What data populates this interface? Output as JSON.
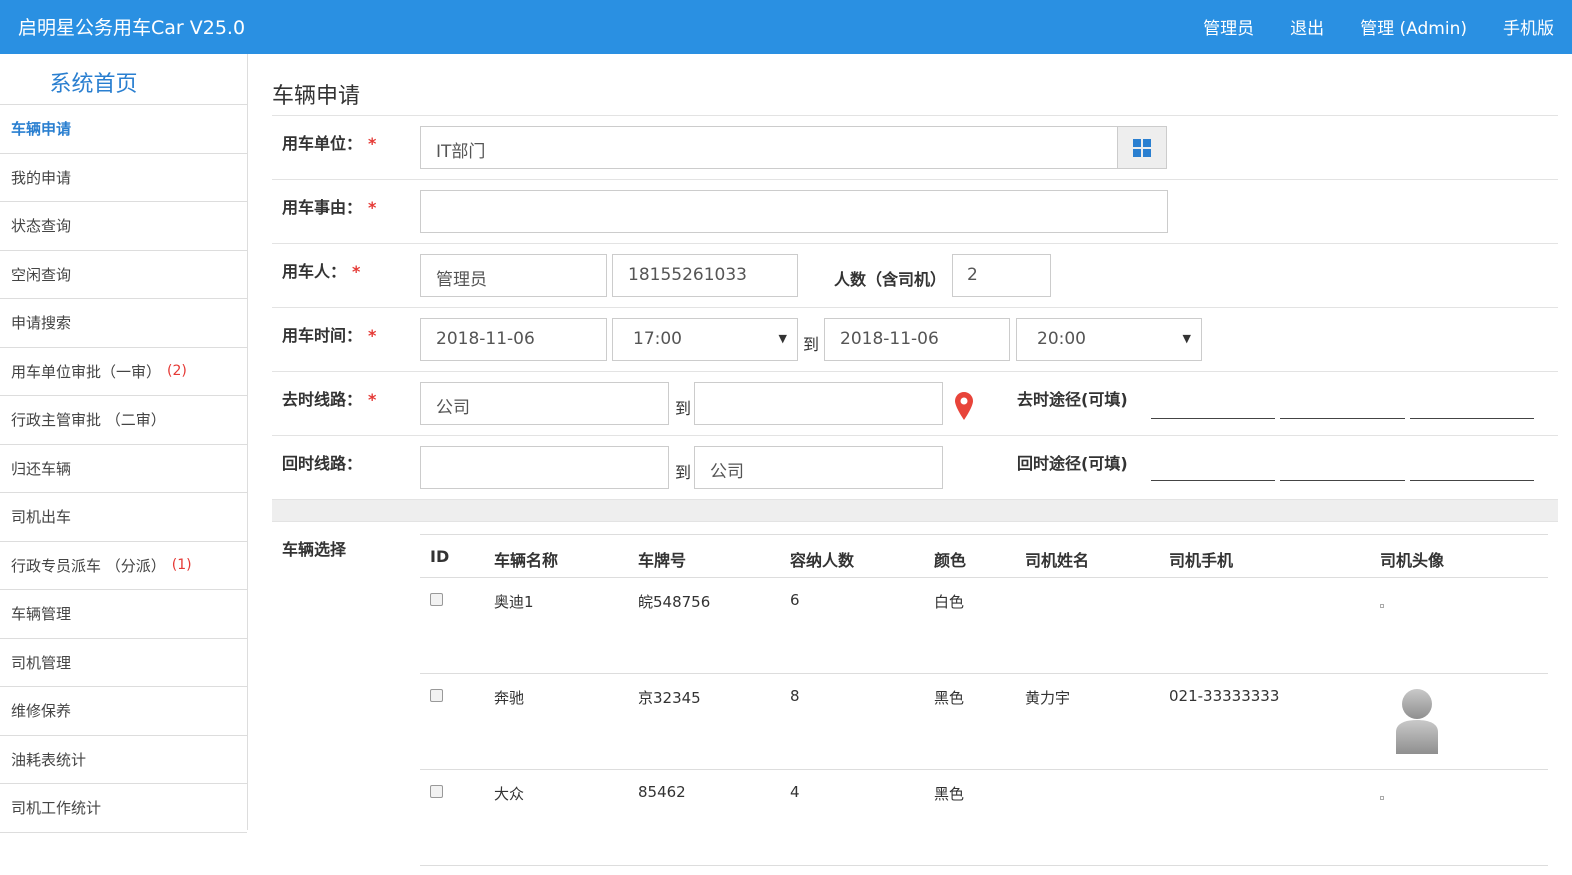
{
  "topbar": {
    "brand": "启明星公务用车Car V25.0",
    "nav": [
      "管理员",
      "退出",
      "管理 (Admin)",
      "手机版"
    ]
  },
  "sidebar": {
    "home": "系统首页",
    "items": [
      {
        "label": "车辆申请",
        "count": ""
      },
      {
        "label": "我的申请",
        "count": ""
      },
      {
        "label": "状态查询",
        "count": ""
      },
      {
        "label": "空闲查询",
        "count": ""
      },
      {
        "label": "申请搜索",
        "count": ""
      },
      {
        "label": "用车单位审批（一审）",
        "count": "(2)"
      },
      {
        "label": "行政主管审批 （二审）",
        "count": ""
      },
      {
        "label": "归还车辆",
        "count": ""
      },
      {
        "label": "司机出车",
        "count": ""
      },
      {
        "label": "行政专员派车 （分派）",
        "count": "(1)"
      },
      {
        "label": "车辆管理",
        "count": ""
      },
      {
        "label": "司机管理",
        "count": ""
      },
      {
        "label": "维修保养",
        "count": ""
      },
      {
        "label": "油耗表统计",
        "count": ""
      },
      {
        "label": "司机工作统计",
        "count": ""
      }
    ]
  },
  "form": {
    "title": "车辆申请",
    "unit_label": "用车单位：",
    "unit_value": "IT部门",
    "reason_label": "用车事由：",
    "reason_value": "",
    "user_label": "用车人：",
    "user_name": "管理员",
    "user_phone": "18155261033",
    "people_label": "人数（含司机）",
    "people_value": "2",
    "time_label": "用车时间：",
    "start_date": "2018-11-06",
    "start_time": "17:00",
    "to": "到",
    "end_date": "2018-11-06",
    "end_time": "20:00",
    "go_label": "去时线路：",
    "go_from": "公司",
    "go_to": "",
    "go_via_label": "去时途径(可填)",
    "back_label": "回时线路：",
    "back_from": "",
    "back_to": "公司",
    "back_via_label": "回时途径(可填)",
    "required_mark": "*"
  },
  "vehicles": {
    "label": "车辆选择",
    "columns": [
      "ID",
      "车辆名称",
      "车牌号",
      "容纳人数",
      "颜色",
      "司机姓名",
      "司机手机",
      "司机头像"
    ],
    "rows": [
      {
        "name": "奥迪1",
        "plate": "皖548756",
        "capacity": "6",
        "color": "白色",
        "driver": "",
        "phone": "",
        "avatar": "none"
      },
      {
        "name": "奔驰",
        "plate": "京32345",
        "capacity": "8",
        "color": "黑色",
        "driver": "黄力宇",
        "phone": "021-33333333",
        "avatar": "person-icon"
      },
      {
        "name": "大众",
        "plate": "85462",
        "capacity": "4",
        "color": "黑色",
        "driver": "",
        "phone": "",
        "avatar": "none"
      }
    ]
  },
  "colors": {
    "brand": "#2a90e2",
    "accent": "#2a7fd0",
    "required": "#e53935",
    "pin": "#e8443a"
  }
}
